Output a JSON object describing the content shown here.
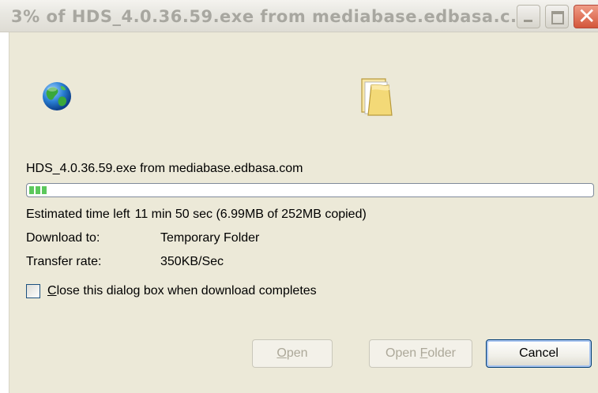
{
  "window": {
    "title": "3% of HDS_4.0.36.59.exe from mediabase.edbasa.c..."
  },
  "icons": {
    "source": "globe-icon",
    "destination": "folder-icon"
  },
  "download": {
    "source_line": "HDS_4.0.36.59.exe from mediabase.edbasa.com",
    "progress_percent": 3,
    "time_left_label": "Estimated time left",
    "time_left_value": "11 min 50 sec (6.99MB of 252MB copied)",
    "download_to_label": "Download to:",
    "download_to_value": "Temporary Folder",
    "transfer_rate_label": "Transfer rate:",
    "transfer_rate_value": "350KB/Sec"
  },
  "options": {
    "close_when_done_label_mnemonic": "C",
    "close_when_done_label_rest": "lose this dialog box when download completes",
    "close_when_done_checked": false
  },
  "buttons": {
    "open_mnemonic": "O",
    "open_rest": "pen",
    "open_folder_prefix": "Open ",
    "open_folder_mnemonic": "F",
    "open_folder_rest": "older",
    "cancel": "Cancel"
  },
  "colors": {
    "progress_fill": "#5cc85c",
    "close_button": "#d4563a",
    "client_bg": "#ece9d8"
  }
}
